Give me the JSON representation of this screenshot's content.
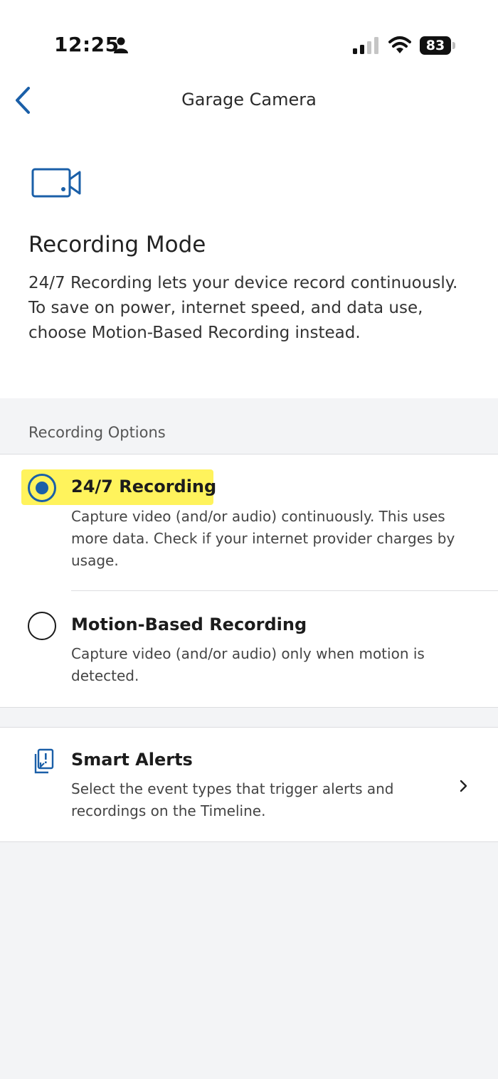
{
  "status_bar": {
    "time": "12:25",
    "battery": "83"
  },
  "nav": {
    "title": "Garage Camera"
  },
  "recording_mode": {
    "title": "Recording Mode",
    "description": "24/7 Recording lets your device record continuously. To save on power, internet speed, and data use, choose Motion-Based Recording instead."
  },
  "recording_options": {
    "header": "Recording Options",
    "selected": "24/7 Recording",
    "options": [
      {
        "title": "24/7 Recording",
        "description": "Capture video (and/or audio) continuously. This uses more data. Check if your internet provider charges by usage."
      },
      {
        "title": "Motion-Based Recording",
        "description": "Capture video (and/or audio) only when motion is detected."
      }
    ]
  },
  "smart_alerts": {
    "title": "Smart Alerts",
    "description": "Select the event types that trigger alerts and recordings on the Timeline."
  },
  "colors": {
    "accent": "#1a5fa8",
    "highlight": "#fff35c",
    "background": "#f3f4f6"
  },
  "icons": [
    "person-icon",
    "signal-icon",
    "wifi-icon",
    "back-icon",
    "camera-icon",
    "alert-icon",
    "chevron-right-icon"
  ]
}
